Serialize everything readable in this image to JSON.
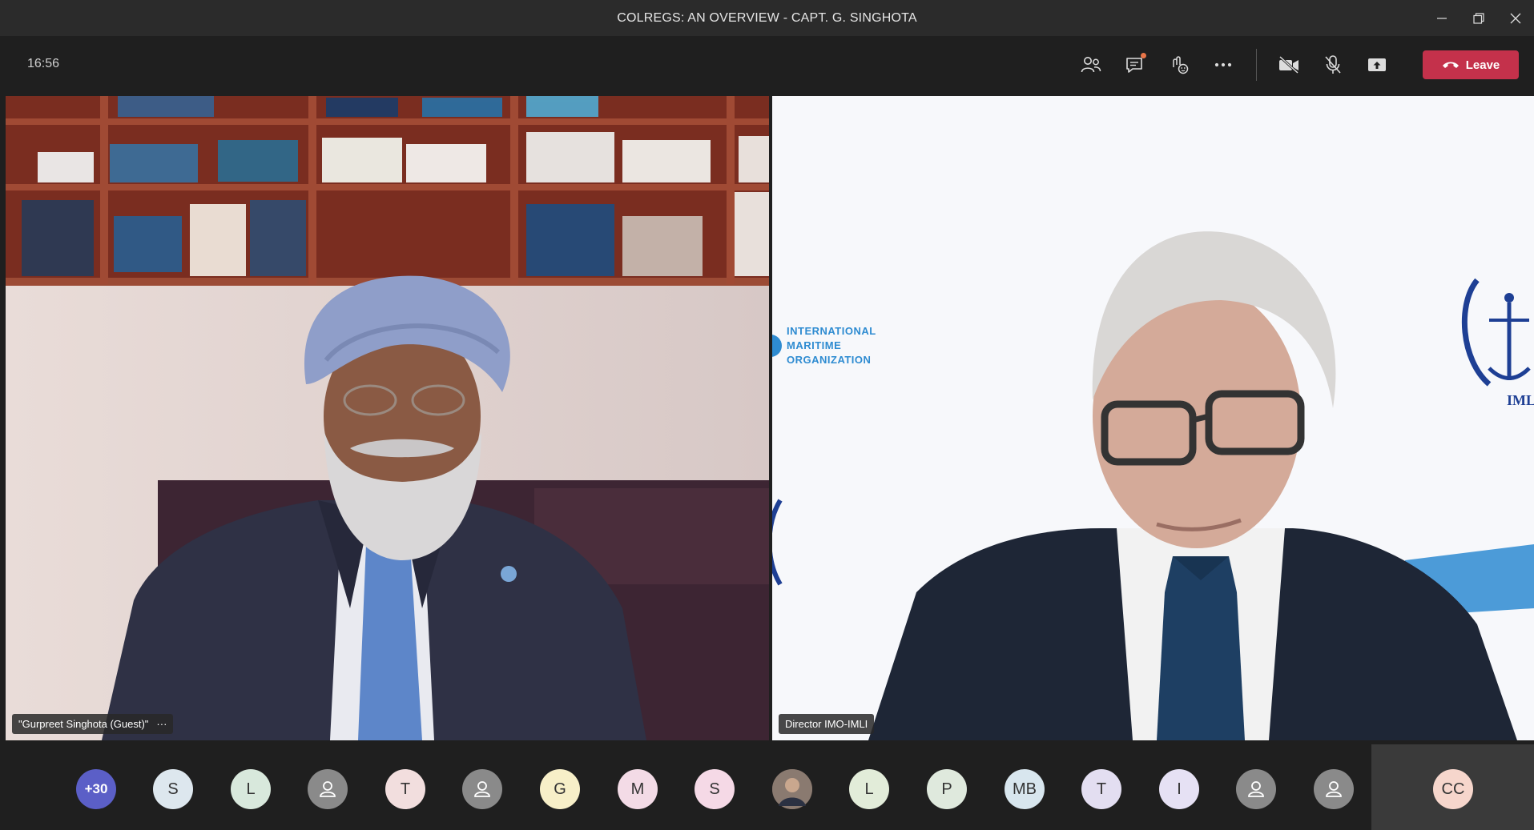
{
  "window": {
    "title": "COLREGS: AN OVERVIEW - CAPT. G. SINGHOTA",
    "controls": [
      "minimize-icon",
      "restore-icon",
      "close-icon"
    ]
  },
  "toolbar": {
    "time": "16:56",
    "leave_label": "Leave"
  },
  "videos": {
    "left": {
      "name": "\"Gurpreet Singhota (Guest)\"",
      "more": "···"
    },
    "right": {
      "name": "Director IMO-IMLI",
      "logo_text": [
        "INTERNATIONAL",
        "MARITIME",
        "ORGANIZATION"
      ],
      "imli_text": "IMLI"
    }
  },
  "participants": {
    "overflow": "+30",
    "list": [
      {
        "initials": "S",
        "color": "#dde7ee"
      },
      {
        "initials": "L",
        "color": "#d8e8dc"
      },
      {
        "initials": "",
        "color": "#8a8a8a",
        "icon": "person"
      },
      {
        "initials": "T",
        "color": "#f2dede"
      },
      {
        "initials": "",
        "color": "#8a8a8a",
        "icon": "person"
      },
      {
        "initials": "G",
        "color": "#f7efc8"
      },
      {
        "initials": "M",
        "color": "#f3dbe6"
      },
      {
        "initials": "S",
        "color": "#f5d9e6"
      },
      {
        "initials": "",
        "color": "#6d5a52",
        "icon": "photo"
      },
      {
        "initials": "L",
        "color": "#e2ecd9"
      },
      {
        "initials": "P",
        "color": "#dfe9dd"
      },
      {
        "initials": "MB",
        "color": "#d8e6ee"
      },
      {
        "initials": "T",
        "color": "#e3def1"
      },
      {
        "initials": "I",
        "color": "#e6e1f4"
      },
      {
        "initials": "",
        "color": "#8a8a8a",
        "icon": "person"
      },
      {
        "initials": "",
        "color": "#8a8a8a",
        "icon": "person"
      }
    ],
    "self": {
      "initials": "CC",
      "color": "#f6d6cc"
    }
  }
}
